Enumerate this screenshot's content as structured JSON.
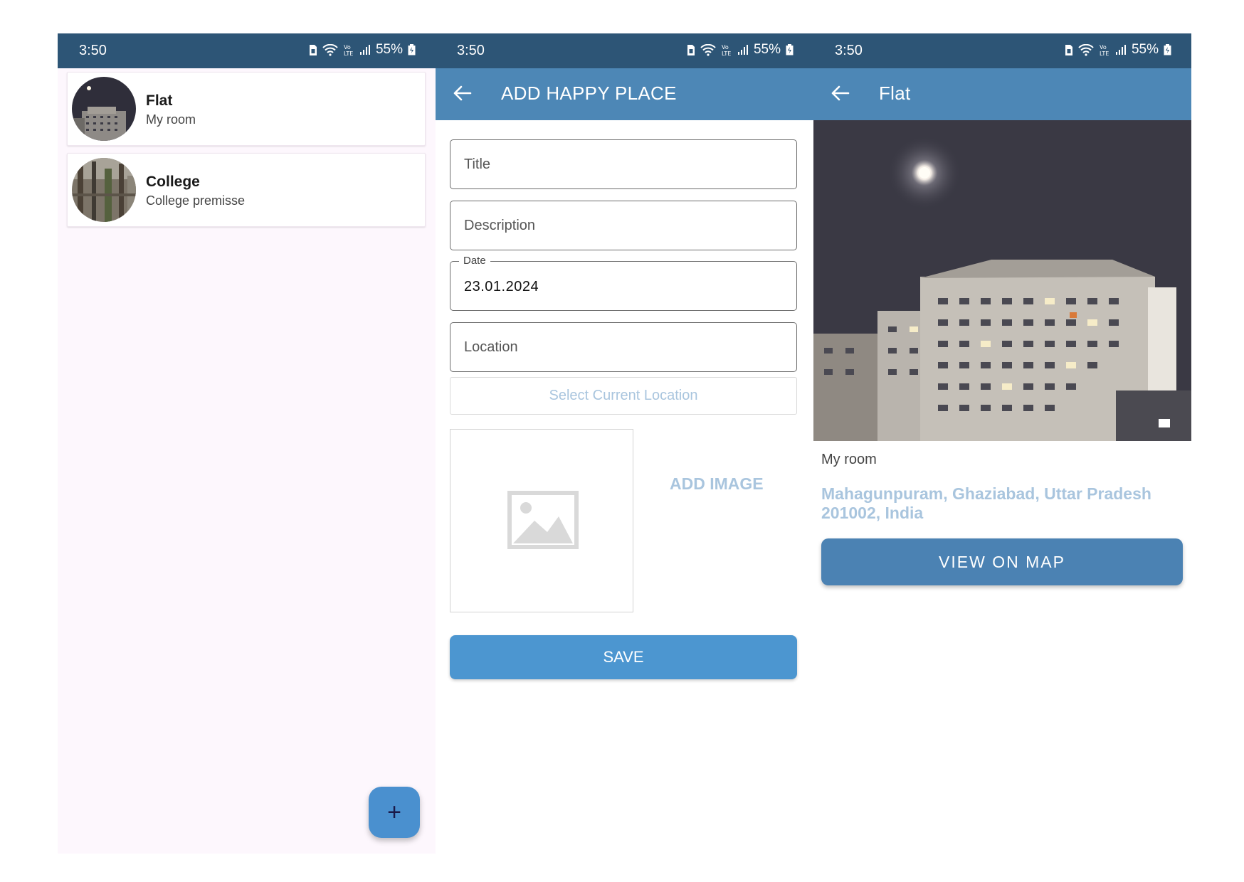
{
  "status_bar": {
    "time": "3:50",
    "battery": "55%"
  },
  "list_screen": {
    "items": [
      {
        "title": "Flat",
        "description": "My room"
      },
      {
        "title": "College",
        "description": "College premisse"
      }
    ],
    "fab_label": "+"
  },
  "form_screen": {
    "title": "ADD HAPPY PLACE",
    "title_placeholder": "Title",
    "description_placeholder": "Description",
    "date_label": "Date",
    "date_value": "23.01.2024",
    "location_placeholder": "Location",
    "select_location_label": "Select Current Location",
    "add_image_label": "ADD IMAGE",
    "save_label": "SAVE"
  },
  "detail_screen": {
    "title": "Flat",
    "description": "My room",
    "location": "Mahagunpuram, Ghaziabad, Uttar Pradesh 201002, India",
    "view_map_label": "VIEW ON MAP"
  },
  "colors": {
    "status_bar": "#2d5576",
    "app_bar": "#4d87b6",
    "save_button": "#4c96d0",
    "map_button": "#4b82b3",
    "accent_text": "#a9c5de",
    "list_background": "#fdf7fd"
  }
}
